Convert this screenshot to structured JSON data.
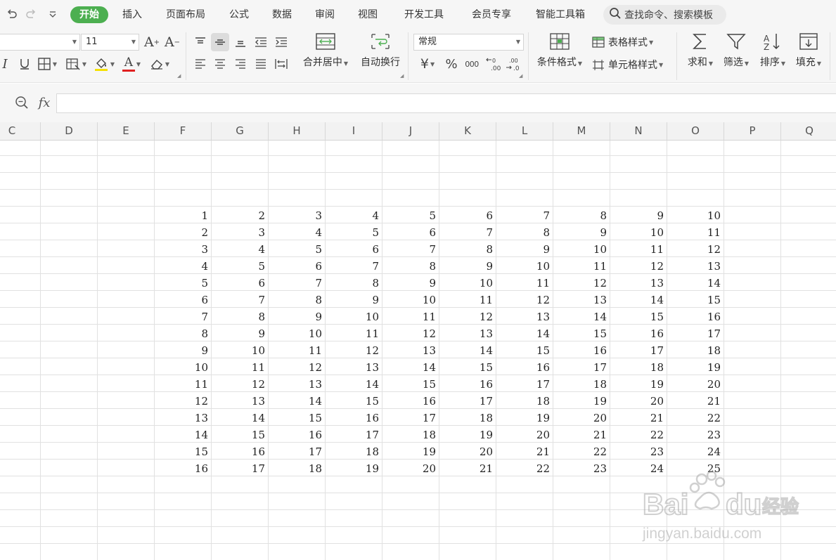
{
  "menu": {
    "tabs": [
      "开始",
      "插入",
      "页面布局",
      "公式",
      "数据",
      "审阅",
      "视图",
      "开发工具",
      "会员专享",
      "智能工具箱"
    ],
    "active_tab": "开始",
    "search_placeholder": "查找命令、搜索模板"
  },
  "ribbon": {
    "font_size": "11",
    "number_format": "常规",
    "merge_label": "合并居中",
    "wrap_label": "自动换行",
    "conditional_label": "条件格式",
    "table_style_label": "表格样式",
    "cell_style_label": "单元格样式",
    "sum_label": "求和",
    "filter_label": "筛选",
    "sort_label": "排序",
    "fill_label": "填充",
    "currency_symbol": "¥",
    "percent_symbol": "%",
    "thousands_symbol": "000",
    "font_grow": "A",
    "font_shrink": "A",
    "font_color_letter": "A"
  },
  "formula_bar": {
    "fx_label": "fx",
    "value": ""
  },
  "sheet": {
    "columns": [
      "C",
      "D",
      "E",
      "F",
      "G",
      "H",
      "I",
      "J",
      "K",
      "L",
      "M",
      "N",
      "O",
      "P",
      "Q"
    ],
    "rows": [
      [
        "1",
        "2",
        "3",
        "4",
        "5",
        "6",
        "7",
        "8",
        "9",
        "10"
      ],
      [
        "2",
        "3",
        "4",
        "5",
        "6",
        "7",
        "8",
        "9",
        "10",
        "11"
      ],
      [
        "3",
        "4",
        "5",
        "6",
        "7",
        "8",
        "9",
        "10",
        "11",
        "12"
      ],
      [
        "4",
        "5",
        "6",
        "7",
        "8",
        "9",
        "10",
        "11",
        "12",
        "13"
      ],
      [
        "5",
        "6",
        "7",
        "8",
        "9",
        "10",
        "11",
        "12",
        "13",
        "14"
      ],
      [
        "6",
        "7",
        "8",
        "9",
        "10",
        "11",
        "12",
        "13",
        "14",
        "15"
      ],
      [
        "7",
        "8",
        "9",
        "10",
        "11",
        "12",
        "13",
        "14",
        "15",
        "16"
      ],
      [
        "8",
        "9",
        "10",
        "11",
        "12",
        "13",
        "14",
        "15",
        "16",
        "17"
      ],
      [
        "9",
        "10",
        "11",
        "12",
        "13",
        "14",
        "15",
        "16",
        "17",
        "18"
      ],
      [
        "10",
        "11",
        "12",
        "13",
        "14",
        "15",
        "16",
        "17",
        "18",
        "19"
      ],
      [
        "11",
        "12",
        "13",
        "14",
        "15",
        "16",
        "17",
        "18",
        "19",
        "20"
      ],
      [
        "12",
        "13",
        "14",
        "15",
        "16",
        "17",
        "18",
        "19",
        "20",
        "21"
      ],
      [
        "13",
        "14",
        "15",
        "16",
        "17",
        "18",
        "19",
        "20",
        "21",
        "22"
      ],
      [
        "14",
        "15",
        "16",
        "17",
        "18",
        "19",
        "20",
        "21",
        "22",
        "23"
      ],
      [
        "15",
        "16",
        "17",
        "18",
        "19",
        "20",
        "21",
        "22",
        "23",
        "24"
      ],
      [
        "16",
        "17",
        "18",
        "19",
        "20",
        "21",
        "22",
        "23",
        "24",
        "25"
      ]
    ]
  },
  "watermark": {
    "brand": "Baidu经验",
    "url": "jingyan.baidu.com"
  },
  "colors": {
    "active_tab_bg": "#4caf50",
    "ribbon_bg": "#f6f6f6",
    "grid_line": "#e1e1e1",
    "font_color_bar": "#e02020",
    "fill_color_bar": "#f5e100"
  }
}
